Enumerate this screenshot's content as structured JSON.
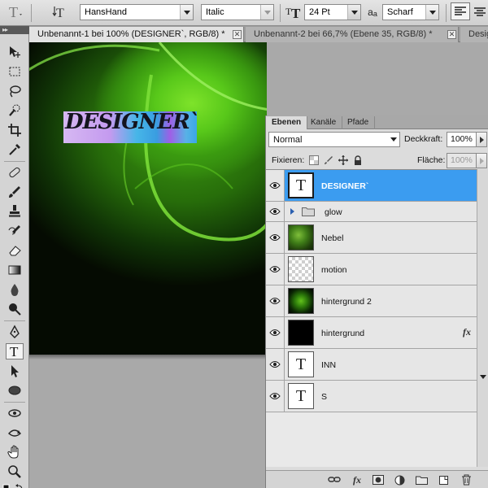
{
  "options_bar": {
    "font_family": "HansHand",
    "font_style": "Italic",
    "font_size": "24 Pt",
    "aa_label": "a",
    "aa_label_sub": "a",
    "antialias": "Scharf"
  },
  "tabs": [
    {
      "label": "Unbenannt-1 bei 100% (DESIGNER`, RGB/8) *",
      "active": true
    },
    {
      "label": "Unbenannt-2 bei 66,7% (Ebene 35, RGB/8) *",
      "active": false
    },
    {
      "label": "Desig",
      "active": false
    }
  ],
  "canvas": {
    "text": "DESIGNER`"
  },
  "layers_panel": {
    "tabs": [
      "Ebenen",
      "Kanäle",
      "Pfade"
    ],
    "blend_mode": "Normal",
    "opacity_label": "Deckkraft:",
    "opacity_value": "100%",
    "lock_label": "Fixieren:",
    "fill_label": "Fläche:",
    "fill_value": "100%",
    "layers": [
      {
        "name": "DESIGNER`",
        "kind": "text",
        "selected": true,
        "fx": ""
      },
      {
        "name": "glow",
        "kind": "group",
        "selected": false,
        "fx": ""
      },
      {
        "name": "Nebel",
        "kind": "image",
        "selected": false,
        "fx": ""
      },
      {
        "name": "motion",
        "kind": "transparent",
        "selected": false,
        "fx": ""
      },
      {
        "name": "hintergrund 2",
        "kind": "radial",
        "selected": false,
        "fx": ""
      },
      {
        "name": "hintergrund",
        "kind": "black",
        "selected": false,
        "fx": "fx"
      },
      {
        "name": "INN",
        "kind": "text",
        "selected": false,
        "fx": ""
      },
      {
        "name": "S",
        "kind": "text",
        "selected": false,
        "fx": ""
      }
    ]
  },
  "icons": {
    "text_thumb_glyph": "T",
    "fx_glyph": "fx"
  },
  "colors": {
    "selection": "#3b9cf0",
    "canvas_glow": "#7ee32a"
  }
}
